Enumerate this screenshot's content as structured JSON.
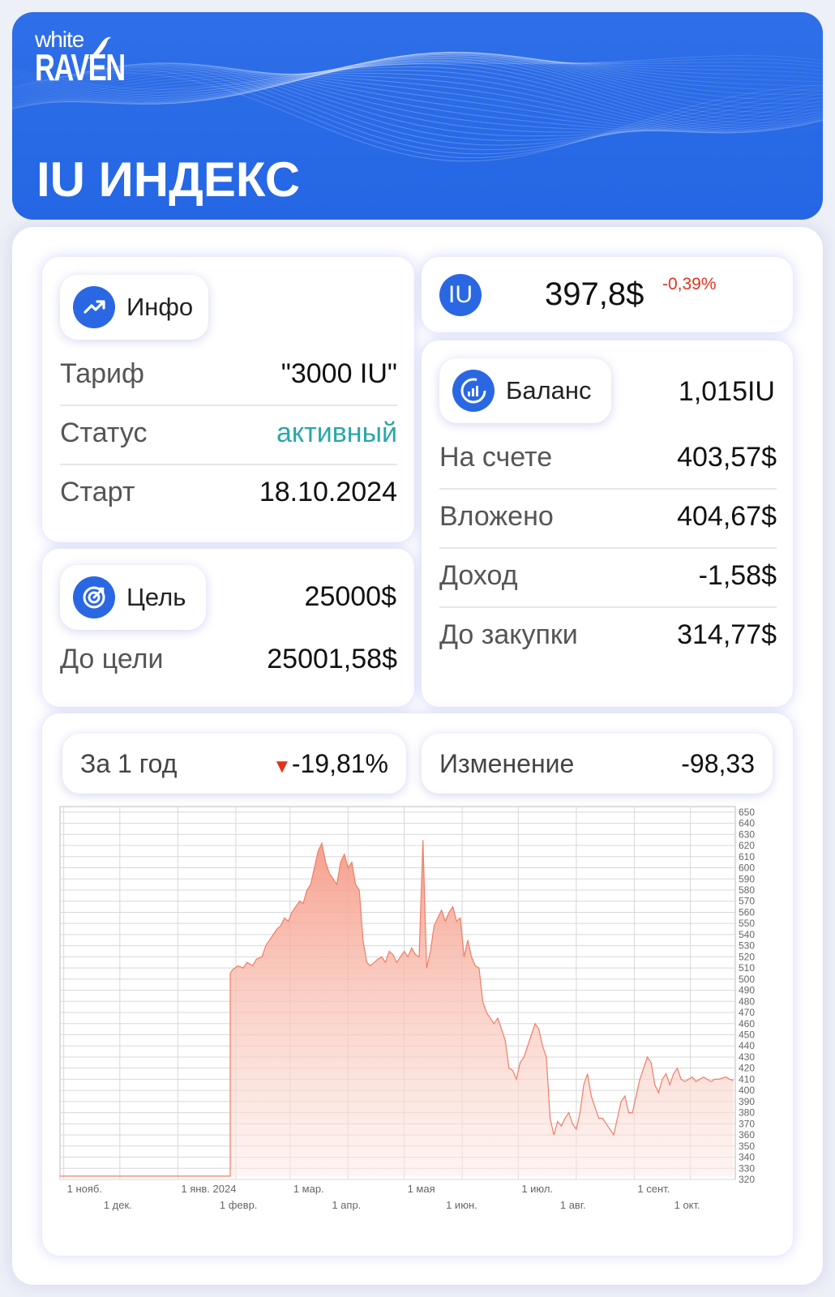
{
  "header": {
    "logo_top": "white",
    "logo_bottom": "RAVEN",
    "title": "IU ИНДЕКС"
  },
  "info": {
    "pill_label": "Инфо",
    "rows": [
      {
        "key": "Тариф",
        "value": "\"3000 IU\""
      },
      {
        "key": "Статус",
        "value": "активный"
      },
      {
        "key": "Старт",
        "value": "18.10.2024"
      }
    ]
  },
  "goal": {
    "pill_label": "Цель",
    "value": "25000$",
    "row_key": "До цели",
    "row_value": "25001,58$"
  },
  "price": {
    "badge": "IU",
    "value": "397,8$",
    "change": "-0,39%"
  },
  "balance": {
    "pill_label": "Баланс",
    "value": "1,015IU",
    "rows": [
      {
        "key": "На счете",
        "value": "403,57$"
      },
      {
        "key": "Вложено",
        "value": "404,67$"
      },
      {
        "key": "Доход",
        "value": "-1,58$"
      },
      {
        "key": "До закупки",
        "value": "314,77$"
      }
    ]
  },
  "period": {
    "label": "За 1 год",
    "arrow": "▼",
    "change": "-19,81%",
    "change_label": "Изменение",
    "change_value": "-98,33"
  },
  "colors": {
    "brand_blue": "#2a67e3",
    "status_green": "#2aa7a9",
    "down_red": "#e0331f",
    "chart_fill_top": "#f59a86",
    "chart_line": "#ef7d66"
  },
  "chart_data": {
    "type": "area",
    "ylim": [
      320,
      655
    ],
    "y_ticks": [
      650,
      640,
      630,
      620,
      610,
      600,
      590,
      580,
      570,
      560,
      550,
      540,
      530,
      520,
      510,
      500,
      490,
      480,
      470,
      460,
      450,
      440,
      430,
      420,
      410,
      400,
      390,
      380,
      370,
      360,
      350,
      340,
      330,
      320
    ],
    "x_labels_top": [
      "1 нояб.",
      "1 янв. 2024",
      "1 мар.",
      "1 мая",
      "1 июл.",
      "1 сент."
    ],
    "x_labels_bottom": [
      "1 дек.",
      "1 февр.",
      "1 апр.",
      "1 июн.",
      "1 авг.",
      "1 окт."
    ],
    "x_start_day": 0,
    "x_end_day": 361,
    "series": [
      {
        "x": [
          91,
          92,
          95,
          98,
          100,
          103,
          105,
          108,
          110,
          112,
          114,
          116,
          118,
          120,
          122,
          124,
          126,
          128,
          130,
          132,
          134,
          136,
          138,
          140,
          142,
          144,
          146,
          148,
          150,
          152,
          154,
          156,
          158,
          160,
          162,
          164,
          166,
          168,
          170,
          172,
          174,
          176,
          178,
          180,
          182,
          184,
          186,
          188,
          190,
          192,
          194,
          196,
          198,
          200,
          202,
          204,
          206,
          208,
          210,
          212,
          214,
          216,
          218,
          220,
          222,
          224,
          226,
          228,
          230,
          232,
          234,
          236,
          238,
          240,
          242,
          244,
          246,
          248,
          250,
          252,
          254,
          256,
          258,
          260,
          262,
          264,
          266,
          268,
          270,
          272,
          274,
          276,
          278,
          280,
          282,
          284,
          286,
          288,
          290,
          292,
          294,
          296,
          298,
          300,
          302,
          304,
          306,
          308,
          310,
          312,
          314,
          316,
          318,
          320,
          322,
          324,
          326,
          328,
          330,
          332,
          334,
          336,
          338,
          340,
          342,
          344,
          346,
          348,
          350,
          352,
          354,
          356,
          358,
          360
        ],
        "y": [
          505,
          508,
          512,
          510,
          515,
          512,
          518,
          520,
          530,
          535,
          540,
          545,
          548,
          555,
          552,
          560,
          565,
          570,
          568,
          580,
          585,
          600,
          615,
          622,
          605,
          595,
          590,
          585,
          605,
          612,
          600,
          605,
          585,
          580,
          535,
          515,
          512,
          515,
          518,
          520,
          515,
          525,
          522,
          515,
          520,
          525,
          520,
          528,
          522,
          520,
          625,
          510,
          525,
          548,
          555,
          562,
          552,
          560,
          565,
          552,
          555,
          520,
          535,
          520,
          512,
          510,
          480,
          470,
          465,
          460,
          465,
          455,
          445,
          420,
          418,
          410,
          425,
          430,
          440,
          450,
          460,
          455,
          440,
          430,
          375,
          360,
          372,
          368,
          375,
          380,
          370,
          365,
          380,
          405,
          415,
          395,
          385,
          375,
          375,
          370,
          365,
          360,
          375,
          390,
          395,
          380,
          380,
          395,
          410,
          420,
          430,
          425,
          405,
          398,
          410,
          415,
          405,
          415,
          420,
          410,
          408,
          410,
          412,
          408,
          410,
          412,
          410,
          408,
          410,
          410,
          411,
          412,
          410,
          409
        ],
        "area_left_day": 91
      }
    ]
  }
}
